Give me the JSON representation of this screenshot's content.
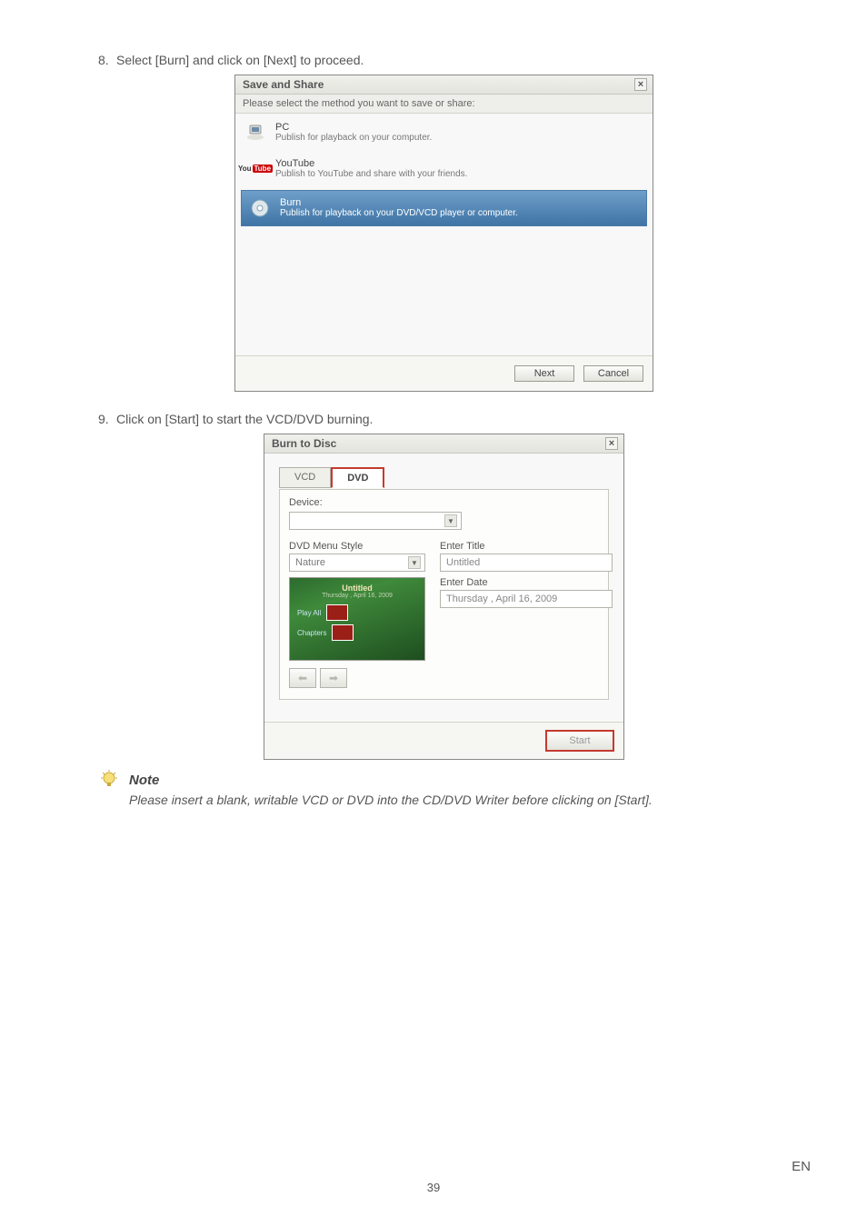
{
  "steps": {
    "s8_num": "8.",
    "s8_text": "Select [Burn] and click on [Next] to proceed.",
    "s9_num": "9.",
    "s9_text": "Click on [Start] to start the VCD/DVD burning."
  },
  "dlg1": {
    "title": "Save and Share",
    "guide": "Please select the method you want to save or share:",
    "pc_title": "PC",
    "pc_sub": "Publish for playback on your computer.",
    "yt_title": "YouTube",
    "yt_sub": "Publish to YouTube and share with your friends.",
    "burn_title": "Burn",
    "burn_sub": "Publish for playback on your DVD/VCD player or computer.",
    "next": "Next",
    "cancel": "Cancel"
  },
  "dlg2": {
    "title": "Burn to Disc",
    "tab_vcd": "VCD",
    "tab_dvd": "DVD",
    "device_label": "Device:",
    "menu_style_label": "DVD Menu Style",
    "menu_style_value": "Nature",
    "enter_title_label": "Enter Title",
    "enter_title_value": "Untitled",
    "enter_date_label": "Enter Date",
    "enter_date_value": "Thursday , April 16, 2009",
    "preview_title": "Untitled",
    "preview_sub": "Thursday , April 16, 2009",
    "preview_play": "Play All",
    "preview_chap": "Chapters",
    "start": "Start"
  },
  "note": {
    "title": "Note",
    "text": "Please insert a blank, writable VCD or DVD into the CD/DVD Writer before clicking on [Start]."
  },
  "page": {
    "num": "39",
    "lang": "EN"
  }
}
